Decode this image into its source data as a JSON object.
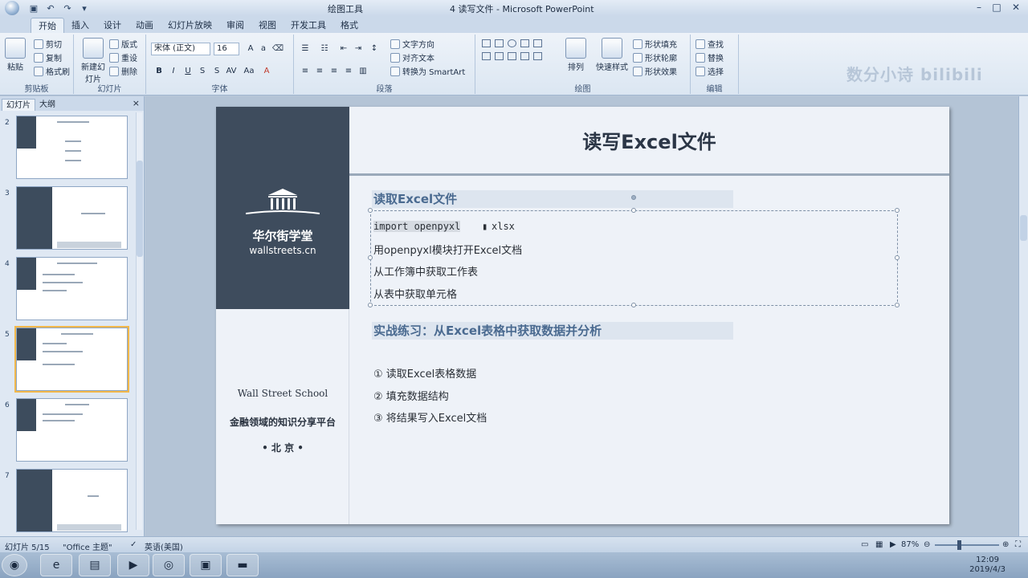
{
  "window": {
    "app_title": "4 读写文件 - Microsoft PowerPoint",
    "context_tool": "绘图工具"
  },
  "ribbon_tabs": [
    "开始",
    "插入",
    "设计",
    "动画",
    "幻灯片放映",
    "审阅",
    "视图",
    "开发工具",
    "格式"
  ],
  "ribbon": {
    "clipboard": {
      "paste": "粘贴",
      "cut": "剪切",
      "copy": "复制",
      "format_painter": "格式刷",
      "label": "剪贴板"
    },
    "slides": {
      "new_slide": "新建幻灯片",
      "layout": "版式",
      "reset": "重设",
      "delete": "删除",
      "label": "幻灯片"
    },
    "font": {
      "font_name": "宋体 (正文)",
      "font_size": "16",
      "label": "字体"
    },
    "paragraph": {
      "text_direction": "文字方向",
      "align_text": "对齐文本",
      "convert_smartart": "转换为 SmartArt",
      "label": "段落"
    },
    "drawing": {
      "arrange": "排列",
      "quick_styles": "快速样式",
      "shape_fill": "形状填充",
      "shape_outline": "形状轮廓",
      "shape_effects": "形状效果",
      "label": "绘图"
    },
    "editing": {
      "find": "查找",
      "replace": "替换",
      "select": "选择",
      "label": "编辑"
    }
  },
  "watermark": "数分小诗 bilibili",
  "left_panel": {
    "tabs": [
      "幻灯片",
      "大纲"
    ],
    "close": "×",
    "thumbnails": [
      {
        "num": "2",
        "selected": false
      },
      {
        "num": "3",
        "selected": false
      },
      {
        "num": "4",
        "selected": false
      },
      {
        "num": "5",
        "selected": true
      },
      {
        "num": "6",
        "selected": false
      },
      {
        "num": "7",
        "selected": false
      }
    ]
  },
  "slide": {
    "brand_cn": "华尔街学堂",
    "brand_en": "wallstreets.cn",
    "school": "Wall Street School",
    "tagline": "金融领域的知识分享平台",
    "city": "• 北 京 •",
    "title": "读写Excel文件",
    "section1": {
      "heading": "读取Excel文件",
      "lines": [
        "import openpyxl ",
        "xlsx",
        "用openpyxl模块打开Excel文档",
        "从工作簿中获取工作表",
        "从表中获取单元格"
      ]
    },
    "section2": {
      "heading": "实战练习：从Excel表格中获取数据并分析",
      "items": [
        "①  读取Excel表格数据",
        "②  填充数据结构",
        "③  将结果写入Excel文档"
      ]
    }
  },
  "status": {
    "slide_info": "幻灯片 5/15",
    "theme": "\"Office 主题\"",
    "language": "英语(美国)",
    "zoom": "87%"
  },
  "taskbar": {
    "time": "12:09",
    "date": "2019/4/3"
  }
}
